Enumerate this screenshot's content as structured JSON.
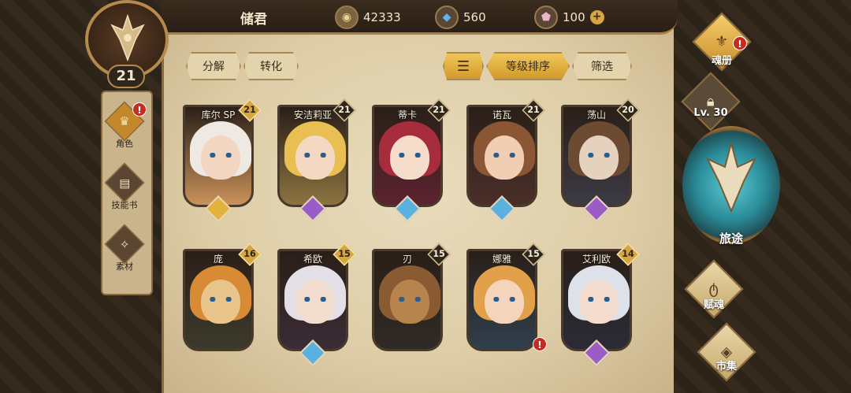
{
  "player": {
    "name": "储君",
    "level": "21"
  },
  "resources": {
    "gold": "42333",
    "crystal": "560",
    "gem": "100"
  },
  "sidebar": {
    "items": [
      {
        "label": "角色"
      },
      {
        "label": "技能书"
      },
      {
        "label": "素材"
      }
    ]
  },
  "actions": {
    "decompose": "分解",
    "convert": "转化",
    "sort_level": "等级排序",
    "filter": "筛选"
  },
  "cards": [
    {
      "name": "库尔 SP",
      "level": "21",
      "gold": true,
      "gem": "#e3b23c",
      "bg": "#c9925a",
      "hair": "#efe9e4",
      "skin": "#f2d6c2"
    },
    {
      "name": "安洁莉亚",
      "level": "21",
      "gold": false,
      "gem": "#9c5cc8",
      "bg": "#8c7440",
      "hair": "#e8bf52",
      "skin": "#f4d8c1"
    },
    {
      "name": "蒂卡",
      "level": "21",
      "gold": false,
      "gem": "#5ab1e0",
      "bg": "#5c2330",
      "hair": "#a72d3c",
      "skin": "#f6dccb"
    },
    {
      "name": "诺瓦",
      "level": "21",
      "gold": false,
      "gem": "#5ab1e0",
      "bg": "#4a2f2a",
      "hair": "#8a5634",
      "skin": "#f0cdb3"
    },
    {
      "name": "荡山",
      "level": "20",
      "gold": false,
      "gem": "#9c5cc8",
      "bg": "#3b3a44",
      "hair": "#6d4b33",
      "skin": "#e4d2be"
    },
    {
      "name": "庞",
      "level": "16",
      "gold": true,
      "gem": "",
      "bg": "#3c3a2c",
      "hair": "#d98a34",
      "skin": "#e9c58b"
    },
    {
      "name": "希欧",
      "level": "15",
      "gold": true,
      "gem": "#5ab1e0",
      "bg": "#3a2c35",
      "hair": "#e2e0e6",
      "skin": "#f1dccd"
    },
    {
      "name": "刃",
      "level": "15",
      "gold": false,
      "gem": "",
      "bg": "#2e2a26",
      "hair": "#8a5a33",
      "skin": "#b7844e"
    },
    {
      "name": "娜雅",
      "level": "15",
      "gold": false,
      "gem": "",
      "bg": "#2f3f4d",
      "hair": "#e3a04a",
      "skin": "#f4d5bc"
    },
    {
      "name": "艾利欧",
      "level": "14",
      "gold": true,
      "gem": "#9c5cc8",
      "bg": "#2b2b36",
      "hair": "#dde2ea",
      "skin": "#f3dccd"
    }
  ],
  "right_nav": {
    "soul_book": "魂册",
    "lock_level": "Lv. 30",
    "journey": "旅途",
    "endow": "赋魂",
    "market": "市集"
  },
  "alert_mark": "!"
}
